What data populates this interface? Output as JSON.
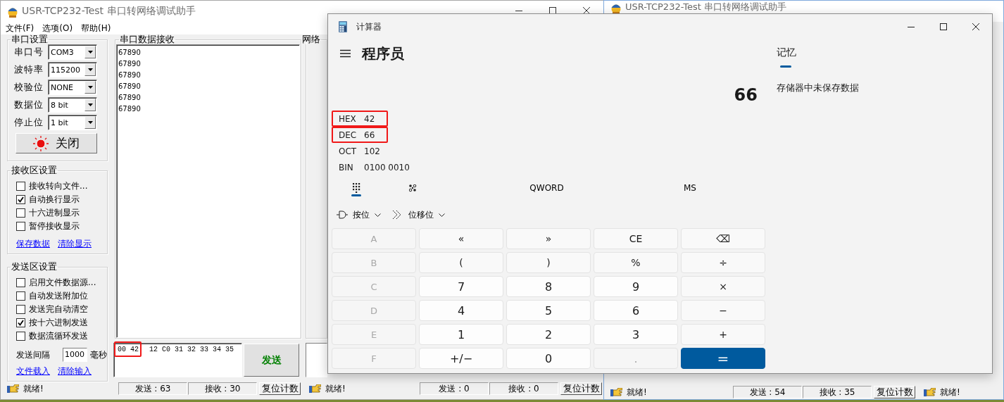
{
  "windows": [
    {
      "title": "USR-TCP232-Test 串口转网络调试助手",
      "controls": true,
      "menu": [
        "文件(F)",
        "选项(O)",
        "帮助(H)"
      ],
      "serial_settings": {
        "title": "串口设置",
        "fields": [
          {
            "label": "串口号",
            "value": "COM3"
          },
          {
            "label": "波特率",
            "value": "115200"
          },
          {
            "label": "校验位",
            "value": "NONE"
          },
          {
            "label": "数据位",
            "value": "8 bit"
          },
          {
            "label": "停止位",
            "value": "1 bit"
          }
        ],
        "port_button": "关闭"
      },
      "receive_settings": {
        "title": "接收区设置",
        "options": [
          {
            "label": "接收转向文件...",
            "checked": false
          },
          {
            "label": "自动换行显示",
            "checked": true
          },
          {
            "label": "十六进制显示",
            "checked": false
          },
          {
            "label": "暂停接收显示",
            "checked": false
          }
        ],
        "links": [
          "保存数据",
          "清除显示"
        ]
      },
      "send_settings": {
        "title": "发送区设置",
        "options": [
          {
            "label": "启用文件数据源...",
            "checked": false
          },
          {
            "label": "自动发送附加位",
            "checked": false
          },
          {
            "label": "发送完自动清空",
            "checked": false
          },
          {
            "label": "按十六进制发送",
            "checked": true
          },
          {
            "label": "数据流循环发送",
            "checked": false
          }
        ],
        "interval": {
          "label": "发送间隔",
          "value": "1000",
          "unit": "毫秒"
        },
        "links": [
          "文件载入",
          "清除输入"
        ]
      },
      "receive_panel": {
        "title": "串口数据接收",
        "lines": [
          "67890",
          "67890",
          "67890",
          "67890",
          "67890",
          "67890"
        ]
      },
      "send_input": {
        "segments": [
          {
            "text": "00 42",
            "highlighted": true
          },
          {
            "text": "12 C0 31 32 33 34 35",
            "highlighted": false
          }
        ]
      },
      "send_button": "发送",
      "network_panel": {
        "title": "网络"
      },
      "status": {
        "serial": {
          "text": "就绪!",
          "sent": "发送 : 63",
          "received": "接收 : 30",
          "reset": "复位计数"
        },
        "network": {
          "text": "就绪!",
          "sent": "发送 : 0",
          "received": "接收 : 0",
          "reset": "复位计数"
        }
      }
    },
    {
      "title": "USR-TCP232-Test 串口转网络调试助手",
      "status": {
        "serial": {
          "text": "就绪!",
          "sent": "发送 : 54",
          "received": "接收 : 35",
          "reset": "复位计数"
        },
        "network": {
          "text": "就绪!"
        }
      }
    }
  ],
  "calculator": {
    "title": "计算器",
    "mode": "程序员",
    "display": "66",
    "radix": [
      {
        "label": "HEX",
        "value": "42",
        "highlighted": true
      },
      {
        "label": "DEC",
        "value": "66",
        "highlighted": true
      },
      {
        "label": "OCT",
        "value": "102",
        "highlighted": false
      },
      {
        "label": "BIN",
        "value": "0100 0010",
        "highlighted": false
      }
    ],
    "tabs": [
      {
        "kind": "keypad",
        "selected": true
      },
      {
        "kind": "bits",
        "selected": false
      }
    ],
    "word_size": "QWORD",
    "memory_store": "MS",
    "ops": [
      {
        "kind": "bitwise",
        "label": "按位"
      },
      {
        "kind": "shift",
        "label": "位移位"
      }
    ],
    "keys": [
      {
        "label": "A",
        "kind": "letter",
        "disabled": true
      },
      {
        "label": "«",
        "kind": "op",
        "disabled": false
      },
      {
        "label": "»",
        "kind": "op",
        "disabled": false
      },
      {
        "label": "CE",
        "kind": "op",
        "disabled": false
      },
      {
        "label": "⌫",
        "kind": "op",
        "disabled": false
      },
      {
        "label": "B",
        "kind": "letter",
        "disabled": true
      },
      {
        "label": "(",
        "kind": "op",
        "disabled": false
      },
      {
        "label": ")",
        "kind": "op",
        "disabled": false
      },
      {
        "label": "%",
        "kind": "op",
        "disabled": false
      },
      {
        "label": "÷",
        "kind": "op",
        "disabled": false
      },
      {
        "label": "C",
        "kind": "letter",
        "disabled": true
      },
      {
        "label": "7",
        "kind": "digit",
        "disabled": false
      },
      {
        "label": "8",
        "kind": "digit",
        "disabled": false
      },
      {
        "label": "9",
        "kind": "digit",
        "disabled": false
      },
      {
        "label": "×",
        "kind": "op",
        "disabled": false
      },
      {
        "label": "D",
        "kind": "letter",
        "disabled": true
      },
      {
        "label": "4",
        "kind": "digit",
        "disabled": false
      },
      {
        "label": "5",
        "kind": "digit",
        "disabled": false
      },
      {
        "label": "6",
        "kind": "digit",
        "disabled": false
      },
      {
        "label": "−",
        "kind": "op",
        "disabled": false
      },
      {
        "label": "E",
        "kind": "letter",
        "disabled": true
      },
      {
        "label": "1",
        "kind": "digit",
        "disabled": false
      },
      {
        "label": "2",
        "kind": "digit",
        "disabled": false
      },
      {
        "label": "3",
        "kind": "digit",
        "disabled": false
      },
      {
        "label": "+",
        "kind": "op",
        "disabled": false
      },
      {
        "label": "F",
        "kind": "letter",
        "disabled": true
      },
      {
        "label": "+/−",
        "kind": "digit",
        "disabled": false
      },
      {
        "label": "0",
        "kind": "digit",
        "disabled": false
      },
      {
        "label": ".",
        "kind": "digit",
        "disabled": true
      },
      {
        "label": "=",
        "kind": "equals",
        "disabled": false
      }
    ],
    "memory": {
      "title": "记忆",
      "empty_text": "存储器中未保存数据"
    }
  }
}
